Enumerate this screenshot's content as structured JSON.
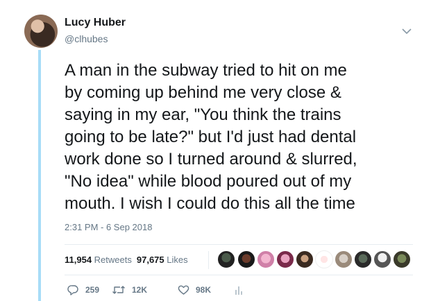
{
  "author": {
    "display_name": "Lucy Huber",
    "handle": "@clhubes"
  },
  "tweet": {
    "text": "A man in the subway tried to hit on me\nby coming up behind me very close &\nsaying in my ear, \"You think the trains\ngoing to be late?\" but I'd just had dental\nwork done so I turned around & slurred,\n\"No idea\" while blood poured out of my\nmouth. I wish I could do this all the time",
    "timestamp": "2:31 PM - 6 Sep 2018"
  },
  "stats": {
    "retweets_count": "11,954",
    "retweets_label": "Retweets",
    "likes_count": "97,675",
    "likes_label": "Likes"
  },
  "actions": {
    "reply_count": "259",
    "retweet_count": "12K",
    "like_count": "98K"
  },
  "icons": {
    "menu": "chevron-down-icon",
    "reply": "reply-icon",
    "retweet": "retweet-icon",
    "like": "heart-icon",
    "analytics": "analytics-icon"
  },
  "colors": {
    "thread_line": "#a7dcf7",
    "secondary_text": "#657786",
    "primary_text": "#14171a"
  }
}
